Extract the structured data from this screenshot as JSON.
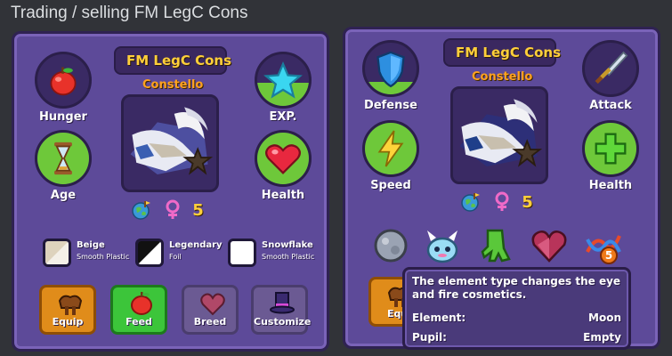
{
  "header": {
    "title": "Trading / selling FM LegC Cons"
  },
  "colors": {
    "accent_gold": "#ffcf3a",
    "panel_purple": "#5d4a99",
    "fill_green": "#6ec83a"
  },
  "left_panel": {
    "badge": "FM LegC Cons",
    "pet_name": "Constello",
    "stats": [
      {
        "label": "Hunger",
        "icon": "apple-icon",
        "level": 0.0
      },
      {
        "label": "EXP.",
        "icon": "star-icon",
        "level": 0.45
      },
      {
        "label": "Age",
        "icon": "hourglass-icon",
        "level": 1.0
      },
      {
        "label": "Health",
        "icon": "heart-icon",
        "level": 1.0
      }
    ],
    "age_number": "5",
    "swatches": [
      {
        "name": "Beige",
        "material": "Smooth Plastic",
        "color": "#ded3bd"
      },
      {
        "name": "Legendary",
        "material": "Foil",
        "color": "#111111"
      },
      {
        "name": "Snowflake",
        "material": "Smooth Plastic",
        "color": "#ffffff"
      }
    ],
    "actions": [
      {
        "label": "Equip",
        "icon": "saddle-icon"
      },
      {
        "label": "Feed",
        "icon": "apple-icon"
      },
      {
        "label": "Breed",
        "icon": "heart-icon"
      },
      {
        "label": "Customize",
        "icon": "top-hat-icon"
      }
    ]
  },
  "right_panel": {
    "badge": "FM LegC Cons",
    "pet_name": "Constello",
    "stats": [
      {
        "label": "Defense",
        "icon": "shield-icon",
        "level": 0.25
      },
      {
        "label": "Attack",
        "icon": "sword-icon",
        "level": 0.0
      },
      {
        "label": "Speed",
        "icon": "lightning-icon",
        "level": 1.0
      },
      {
        "label": "Health",
        "icon": "plus-icon",
        "level": 1.0
      }
    ],
    "age_number": "5",
    "accessories": [
      {
        "icon": "moon-orb-icon"
      },
      {
        "icon": "dragon-pet-icon"
      },
      {
        "icon": "green-claw-icon"
      },
      {
        "icon": "heart-gem-icon"
      },
      {
        "icon": "dna-icon",
        "badge": "5"
      }
    ],
    "partial_action": {
      "label": "Equ",
      "icon": "saddle-icon"
    }
  },
  "tooltip": {
    "description": "The element type changes the eye and fire cosmetics.",
    "rows": [
      {
        "key": "Element:",
        "value": "Moon"
      },
      {
        "key": "Pupil:",
        "value": "Empty"
      }
    ]
  }
}
